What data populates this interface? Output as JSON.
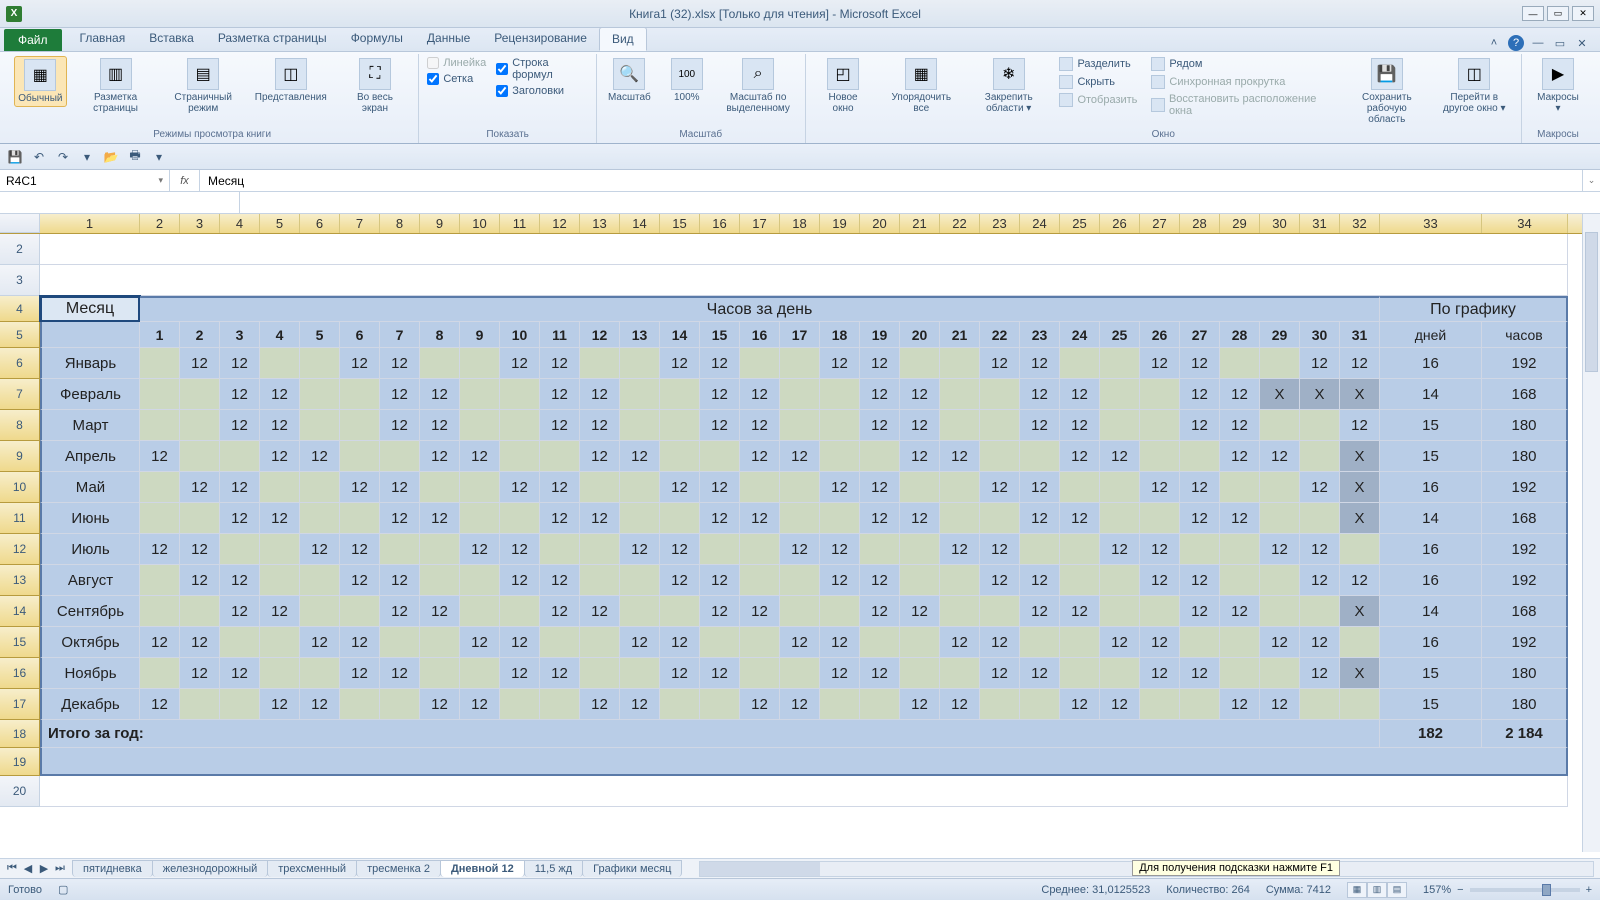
{
  "title": "Книга1 (32).xlsx  [Только для чтения]  -  Microsoft Excel",
  "file_tab": "Файл",
  "tabs": [
    "Главная",
    "Вставка",
    "Разметка страницы",
    "Формулы",
    "Данные",
    "Рецензирование",
    "Вид"
  ],
  "active_tab": 6,
  "ribbon": {
    "g1": {
      "label": "Режимы просмотра книги",
      "btn1": "Обычный",
      "btn2": "Разметка\nстраницы",
      "btn3": "Страничный\nрежим",
      "btn4": "Представления",
      "btn5": "Во весь\nэкран"
    },
    "g2": {
      "label": "Показать",
      "c1": "Линейка",
      "c2": "Строка формул",
      "c3": "Сетка",
      "c4": "Заголовки"
    },
    "g3": {
      "label": "Масштаб",
      "b1": "Масштаб",
      "b2": "100%",
      "b3": "Масштаб по\nвыделенному"
    },
    "g4": {
      "label": "Окно",
      "b1": "Новое\nокно",
      "b2": "Упорядочить\nвсе",
      "b3": "Закрепить\nобласти ▾",
      "s1": "Разделить",
      "s2": "Скрыть",
      "s3": "Отобразить",
      "s4": "Рядом",
      "s5": "Синхронная прокрутка",
      "s6": "Восстановить расположение окна",
      "b4": "Сохранить\nрабочую область",
      "b5": "Перейти в\nдругое окно ▾"
    },
    "g5": {
      "label": "Макросы",
      "b1": "Макросы\n▾"
    }
  },
  "namebox": "R4C1",
  "fx_label": "fx",
  "fx_value": "Месяц",
  "col_nums": [
    "1",
    "2",
    "3",
    "4",
    "5",
    "6",
    "7",
    "8",
    "9",
    "10",
    "11",
    "12",
    "13",
    "14",
    "15",
    "16",
    "17",
    "18",
    "19",
    "20",
    "21",
    "22",
    "23",
    "24",
    "25",
    "26",
    "27",
    "28",
    "29",
    "30",
    "31",
    "32",
    "33",
    "34"
  ],
  "row_nums": [
    "2",
    "3",
    "4",
    "5",
    "6",
    "7",
    "8",
    "9",
    "10",
    "11",
    "12",
    "13",
    "14",
    "15",
    "16",
    "17",
    "18",
    "19",
    "20"
  ],
  "headers": {
    "month": "Месяц",
    "hours_day": "Часов за день",
    "schedule": "По графику",
    "days_col": "дней",
    "hours_col": "часов"
  },
  "days": [
    "1",
    "2",
    "3",
    "4",
    "5",
    "6",
    "7",
    "8",
    "9",
    "10",
    "11",
    "12",
    "13",
    "14",
    "15",
    "16",
    "17",
    "18",
    "19",
    "20",
    "21",
    "22",
    "23",
    "24",
    "25",
    "26",
    "27",
    "28",
    "29",
    "30",
    "31"
  ],
  "months": [
    {
      "name": "Январь",
      "d": [
        "",
        "12",
        "12",
        "",
        "",
        "12",
        "12",
        "",
        "",
        "12",
        "12",
        "",
        "",
        "12",
        "12",
        "",
        "",
        "12",
        "12",
        "",
        "",
        "12",
        "12",
        "",
        "",
        "12",
        "12",
        "",
        "",
        "12",
        "12"
      ],
      "days": "16",
      "hours": "192"
    },
    {
      "name": "Февраль",
      "d": [
        "",
        "",
        "12",
        "12",
        "",
        "",
        "12",
        "12",
        "",
        "",
        "12",
        "12",
        "",
        "",
        "12",
        "12",
        "",
        "",
        "12",
        "12",
        "",
        "",
        "12",
        "12",
        "",
        "",
        "12",
        "12",
        "X",
        "X",
        "X"
      ],
      "days": "14",
      "hours": "168"
    },
    {
      "name": "Март",
      "d": [
        "",
        "",
        "12",
        "12",
        "",
        "",
        "12",
        "12",
        "",
        "",
        "12",
        "12",
        "",
        "",
        "12",
        "12",
        "",
        "",
        "12",
        "12",
        "",
        "",
        "12",
        "12",
        "",
        "",
        "12",
        "12",
        "",
        "",
        "12"
      ],
      "days": "15",
      "hours": "180"
    },
    {
      "name": "Апрель",
      "d": [
        "12",
        "",
        "",
        "12",
        "12",
        "",
        "",
        "12",
        "12",
        "",
        "",
        "12",
        "12",
        "",
        "",
        "12",
        "12",
        "",
        "",
        "12",
        "12",
        "",
        "",
        "12",
        "12",
        "",
        "",
        "12",
        "12",
        "",
        "X"
      ],
      "days": "15",
      "hours": "180"
    },
    {
      "name": "Май",
      "d": [
        "",
        "12",
        "12",
        "",
        "",
        "12",
        "12",
        "",
        "",
        "12",
        "12",
        "",
        "",
        "12",
        "12",
        "",
        "",
        "12",
        "12",
        "",
        "",
        "12",
        "12",
        "",
        "",
        "12",
        "12",
        "",
        "",
        "12",
        "X"
      ],
      "days": "16",
      "hours": "192"
    },
    {
      "name": "Июнь",
      "d": [
        "",
        "",
        "12",
        "12",
        "",
        "",
        "12",
        "12",
        "",
        "",
        "12",
        "12",
        "",
        "",
        "12",
        "12",
        "",
        "",
        "12",
        "12",
        "",
        "",
        "12",
        "12",
        "",
        "",
        "12",
        "12",
        "",
        "",
        "X"
      ],
      "days": "14",
      "hours": "168"
    },
    {
      "name": "Июль",
      "d": [
        "12",
        "12",
        "",
        "",
        "12",
        "12",
        "",
        "",
        "12",
        "12",
        "",
        "",
        "12",
        "12",
        "",
        "",
        "12",
        "12",
        "",
        "",
        "12",
        "12",
        "",
        "",
        "12",
        "12",
        "",
        "",
        "12",
        "12",
        ""
      ],
      "days": "16",
      "hours": "192"
    },
    {
      "name": "Август",
      "d": [
        "",
        "12",
        "12",
        "",
        "",
        "12",
        "12",
        "",
        "",
        "12",
        "12",
        "",
        "",
        "12",
        "12",
        "",
        "",
        "12",
        "12",
        "",
        "",
        "12",
        "12",
        "",
        "",
        "12",
        "12",
        "",
        "",
        "12",
        "12"
      ],
      "days": "16",
      "hours": "192"
    },
    {
      "name": "Сентябрь",
      "d": [
        "",
        "",
        "12",
        "12",
        "",
        "",
        "12",
        "12",
        "",
        "",
        "12",
        "12",
        "",
        "",
        "12",
        "12",
        "",
        "",
        "12",
        "12",
        "",
        "",
        "12",
        "12",
        "",
        "",
        "12",
        "12",
        "",
        "",
        "X"
      ],
      "days": "14",
      "hours": "168"
    },
    {
      "name": "Октябрь",
      "d": [
        "12",
        "12",
        "",
        "",
        "12",
        "12",
        "",
        "",
        "12",
        "12",
        "",
        "",
        "12",
        "12",
        "",
        "",
        "12",
        "12",
        "",
        "",
        "12",
        "12",
        "",
        "",
        "12",
        "12",
        "",
        "",
        "12",
        "12",
        ""
      ],
      "days": "16",
      "hours": "192"
    },
    {
      "name": "Ноябрь",
      "d": [
        "",
        "12",
        "12",
        "",
        "",
        "12",
        "12",
        "",
        "",
        "12",
        "12",
        "",
        "",
        "12",
        "12",
        "",
        "",
        "12",
        "12",
        "",
        "",
        "12",
        "12",
        "",
        "",
        "12",
        "12",
        "",
        "",
        "12",
        "X"
      ],
      "days": "15",
      "hours": "180"
    },
    {
      "name": "Декабрь",
      "d": [
        "12",
        "",
        "",
        "12",
        "12",
        "",
        "",
        "12",
        "12",
        "",
        "",
        "12",
        "12",
        "",
        "",
        "12",
        "12",
        "",
        "",
        "12",
        "12",
        "",
        "",
        "12",
        "12",
        "",
        "",
        "12",
        "12",
        "",
        ""
      ],
      "days": "15",
      "hours": "180"
    }
  ],
  "total_label": "Итого за год:",
  "total_days": "182",
  "total_hours": "2 184",
  "sheet_tabs": [
    "пятидневка",
    "железнодорожный",
    "трехсменный",
    "тресменка 2",
    "Дневной 12",
    "11,5 жд",
    "Графики месяц"
  ],
  "sheet_active": 4,
  "tooltip": "Для получения подсказки нажмите F1",
  "status": {
    "ready": "Готово",
    "avg": "Среднее: 31,0125523",
    "count": "Количество: 264",
    "sum": "Сумма: 7412",
    "zoom": "157%"
  }
}
